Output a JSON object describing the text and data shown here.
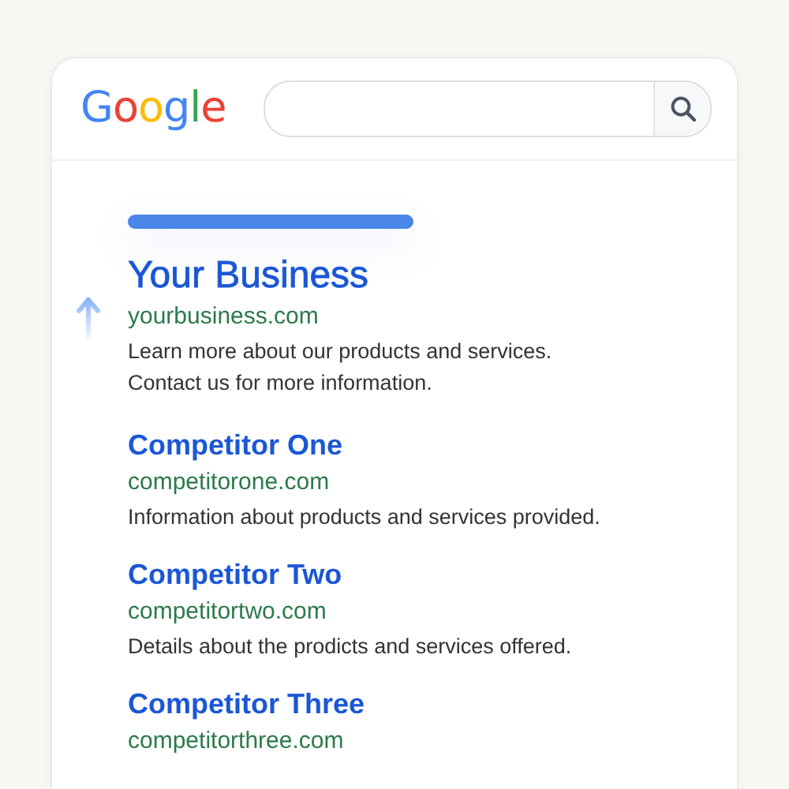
{
  "logo": "Google",
  "results": [
    {
      "title": "Your Business",
      "url": "yourbusiness.com",
      "snippet": "Learn more about our products and services.\nContact us for more information.",
      "featured": true
    },
    {
      "title": "Competitor One",
      "url": "competitorone.com",
      "snippet": "Information about products and services provided.",
      "featured": false
    },
    {
      "title": "Competitor Two",
      "url": "competitortwo.com",
      "snippet": "Details about the prodicts and services offered.",
      "featured": false
    },
    {
      "title": "Competitor Three",
      "url": "competitorthree.com",
      "featured": false
    }
  ]
}
